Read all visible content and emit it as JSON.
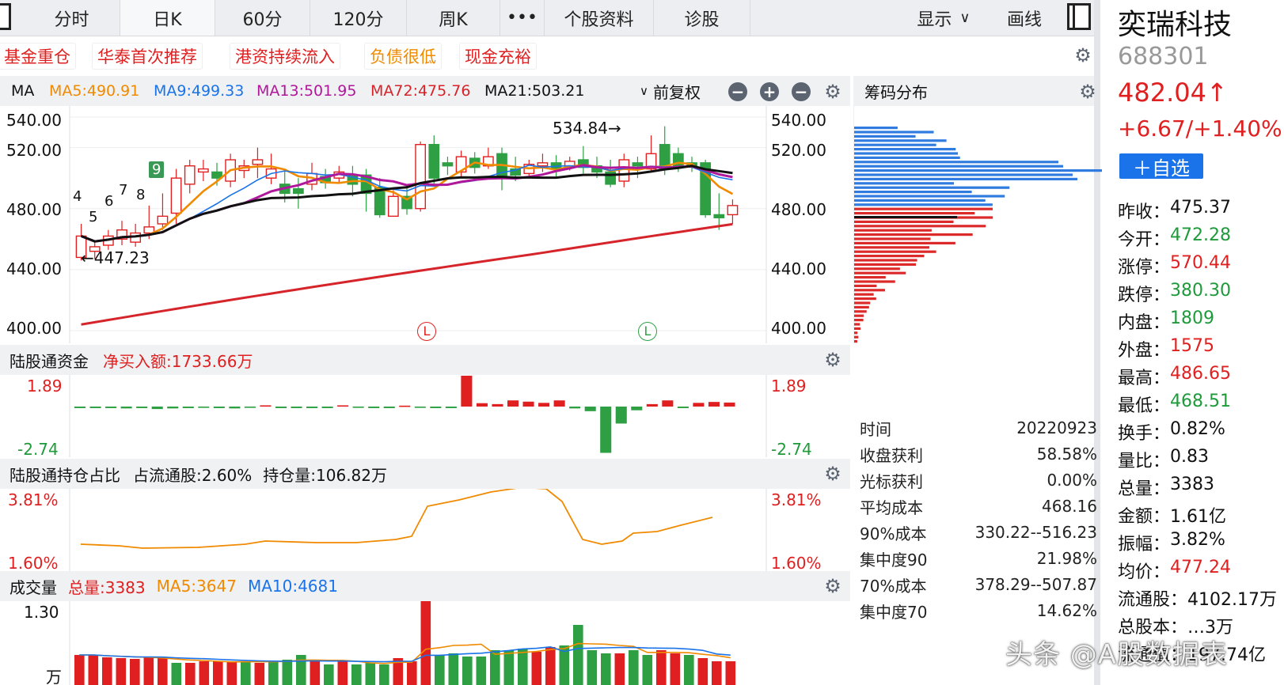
{
  "tabs": [
    "分时",
    "日K",
    "60分",
    "120分",
    "周K",
    "•••",
    "个股资料",
    "诊股"
  ],
  "active_tab": "日K",
  "display_label": "显示",
  "draw_label": "画线",
  "tags": [
    "基金重仓",
    "华泰首次推荐",
    "港资持续流入",
    "负债很低",
    "现金充裕"
  ],
  "ma_bar": {
    "label": "MA",
    "ma5": "MA5:490.91",
    "ma9": "MA9:499.33",
    "ma13": "MA13:501.95",
    "ma72": "MA72:475.76",
    "ma21": "MA21:503.21",
    "adjust": "前复权"
  },
  "chip_title": "筹码分布",
  "main_chart": {
    "y_ticks": [
      "540.00",
      "520.00",
      "480.00",
      "440.00",
      "400.00"
    ],
    "high_note": "534.84→",
    "low_note": "←447.23",
    "count_labels": [
      "4",
      "5",
      "6",
      "7",
      "8",
      "9"
    ],
    "marker_L": "L"
  },
  "flow_panel": {
    "title": "陆股通资金",
    "net": "净买入额:1733.66万",
    "top": "1.89",
    "bottom": "-2.74"
  },
  "hold_panel": {
    "title": "陆股通持仓占比",
    "ratio": "占流通股:2.60%",
    "qty": "持仓量:106.82万",
    "top": "3.81%",
    "bottom": "1.60%"
  },
  "vol_panel": {
    "title": "成交量",
    "total": "总量:3383",
    "ma5": "MA5:3647",
    "ma10": "MA10:4681",
    "top": "1.30",
    "unit": "万"
  },
  "chip_stats": [
    {
      "k": "时间",
      "v": "20220923"
    },
    {
      "k": "收盘获利",
      "v": "58.58%"
    },
    {
      "k": "光标获利",
      "v": "0.00%"
    },
    {
      "k": "平均成本",
      "v": "468.16"
    },
    {
      "k": "90%成本",
      "v": "330.22--516.23"
    },
    {
      "k": "集中度90",
      "v": "21.98%"
    },
    {
      "k": "70%成本",
      "v": "378.29--507.87"
    },
    {
      "k": "集中度70",
      "v": "14.62%"
    }
  ],
  "quote": {
    "name": "奕瑞科技",
    "code": "688301",
    "price": "482.04",
    "arrow": "↑",
    "change": "+6.67/+1.40%",
    "watch_btn": "＋自选",
    "rows": [
      {
        "k": "昨收：",
        "v": "475.37",
        "c": "black"
      },
      {
        "k": "今开：",
        "v": "472.28",
        "c": "green"
      },
      {
        "k": "涨停：",
        "v": "570.44",
        "c": "red"
      },
      {
        "k": "跌停：",
        "v": "380.30",
        "c": "green"
      },
      {
        "k": "内盘：",
        "v": "1809",
        "c": "green"
      },
      {
        "k": "外盘：",
        "v": "1575",
        "c": "red"
      },
      {
        "k": "最高：",
        "v": "486.65",
        "c": "red"
      },
      {
        "k": "最低：",
        "v": "468.51",
        "c": "green"
      },
      {
        "k": "换手：",
        "v": "0.82%",
        "c": "black"
      },
      {
        "k": "量比：",
        "v": "0.83",
        "c": "black"
      },
      {
        "k": "总量：",
        "v": "3383",
        "c": "black"
      },
      {
        "k": "金额：",
        "v": "1.61亿",
        "c": "black"
      },
      {
        "k": "振幅：",
        "v": "3.82%",
        "c": "black"
      },
      {
        "k": "均价：",
        "v": "477.24",
        "c": "red"
      },
      {
        "k": "流通股：",
        "v": "4102.17万",
        "c": "black"
      },
      {
        "k": "总股本：",
        "v": "…3万",
        "c": "black"
      },
      {
        "k": "流通值：",
        "v": "197.74亿",
        "c": "black"
      }
    ]
  },
  "watermark": "头条 @A股数据表",
  "colors": {
    "up": "#e02020",
    "down": "#2ea043",
    "ma5": "#f08a00",
    "ma9": "#1a73e8",
    "ma13": "#b0189c",
    "ma72": "#d6242b",
    "ma21": "#111111"
  }
}
